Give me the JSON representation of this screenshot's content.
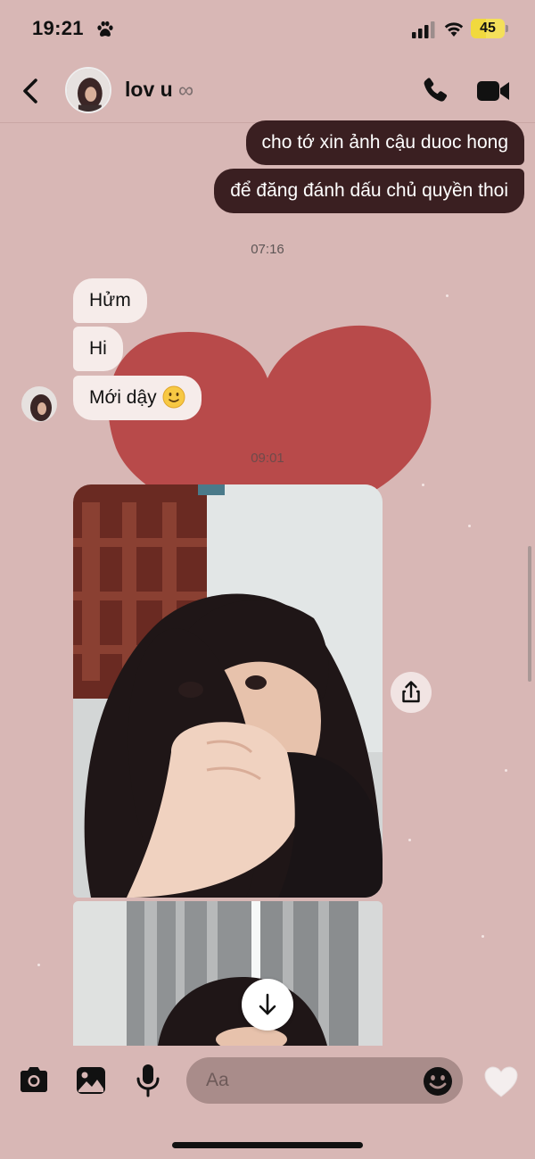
{
  "status_bar": {
    "time": "19:21",
    "battery_percent": 45,
    "battery_label": "45",
    "colors": {
      "battery": "#f4e05a"
    }
  },
  "header": {
    "contact_name": "lov u",
    "infinity_symbol": "∞",
    "icons": [
      "chevron-left-icon",
      "paw-icon",
      "phone-icon",
      "video-camera-icon",
      "infinity-icon"
    ]
  },
  "messages": {
    "outgoing": [
      "cho tớ xin ảnh cậu duoc hong",
      "để đăng đánh dấu chủ quyền thoi"
    ],
    "timestamp_1": "07:16",
    "incoming": [
      "Hửm",
      "Hi",
      "Mới dậy"
    ],
    "timestamp_2": "09:01"
  },
  "composer": {
    "placeholder": "Aa",
    "icons": [
      "camera-icon",
      "image-icon",
      "microphone-icon",
      "emoji-icon",
      "heart-icon"
    ]
  },
  "colors": {
    "background": "#d8b7b5",
    "outgoing_bubble": "#3a1f21",
    "incoming_bubble": "#f6ecea",
    "heart_sticker": "#b84a4a"
  }
}
